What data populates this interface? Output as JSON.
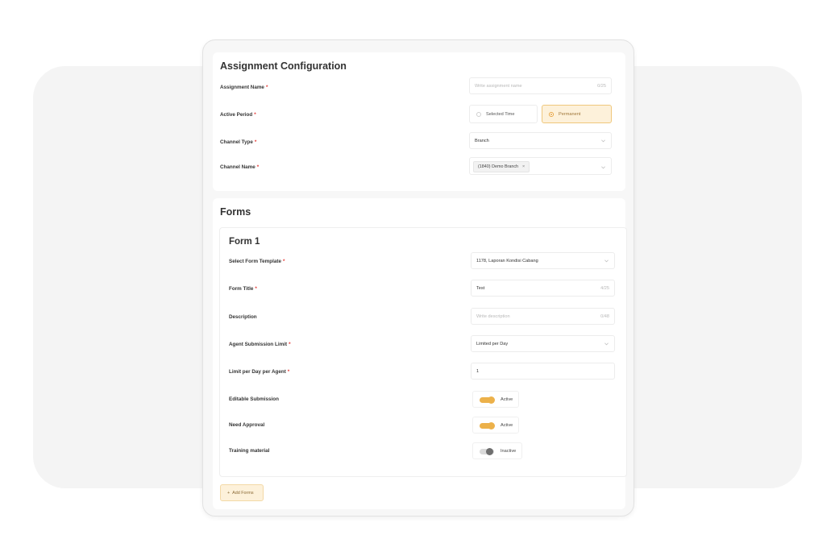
{
  "assignment_config": {
    "title": "Assignment Configuration",
    "assignment_name": {
      "label": "Assignment Name",
      "required": "*",
      "placeholder": "Write assignment name",
      "counter": "0/25"
    },
    "active_period": {
      "label": "Active Period",
      "required": "*",
      "options": [
        "Selected Time",
        "Permanent"
      ],
      "selected": "Permanent"
    },
    "channel_type": {
      "label": "Channel Type",
      "required": "*",
      "value": "Branch"
    },
    "channel_name": {
      "label": "Channel Name",
      "required": "*",
      "tag": "(1840) Demo Branch",
      "tag_remove": "×"
    }
  },
  "forms": {
    "title": "Forms",
    "form1": {
      "title": "Form 1",
      "select_template": {
        "label": "Select Form Template",
        "required": "*",
        "value": "1178, Laporan Kondisi Cabang"
      },
      "form_title": {
        "label": "Form Title",
        "required": "*",
        "value": "Test",
        "counter": "4/25"
      },
      "description": {
        "label": "Description",
        "placeholder": "Write description",
        "counter": "0/48"
      },
      "agent_limit": {
        "label": "Agent Submission Limit",
        "required": "*",
        "value": "Limited per Day"
      },
      "limit_per_day": {
        "label": "Limit per Day per Agent",
        "required": "*",
        "value": "1"
      },
      "editable_submission": {
        "label": "Editable Submission",
        "state": "Active"
      },
      "need_approval": {
        "label": "Need Approval",
        "state": "Active"
      },
      "training_material": {
        "label": "Training material",
        "state": "Inactive"
      }
    },
    "add_button": {
      "icon": "+",
      "label": "Add Forms"
    }
  },
  "colors": {
    "accent": "#ecb14a",
    "accent_bg": "#fdf1da",
    "required": "#e53935"
  }
}
